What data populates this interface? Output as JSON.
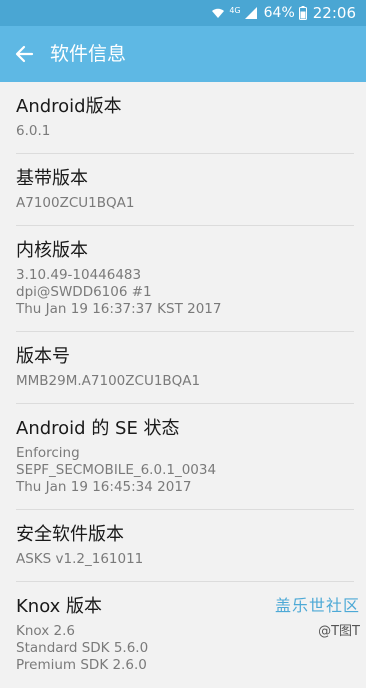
{
  "status_bar": {
    "network": "4G",
    "battery": "64%",
    "time": "22:06"
  },
  "app_bar": {
    "title": "软件信息"
  },
  "items": [
    {
      "label": "Android版本",
      "values": [
        "6.0.1"
      ]
    },
    {
      "label": "基带版本",
      "values": [
        "A7100ZCU1BQA1"
      ]
    },
    {
      "label": "内核版本",
      "values": [
        "3.10.49-10446483",
        "dpi@SWDD6106 #1",
        "Thu Jan 19 16:37:37 KST 2017"
      ]
    },
    {
      "label": "版本号",
      "values": [
        "MMB29M.A7100ZCU1BQA1"
      ]
    },
    {
      "label": "Android 的 SE 状态",
      "values": [
        "Enforcing",
        "SEPF_SECMOBILE_6.0.1_0034",
        "Thu Jan 19 16:45:34 2017"
      ]
    },
    {
      "label": "安全软件版本",
      "values": [
        "ASKS v1.2_161011"
      ]
    },
    {
      "label": "Knox 版本",
      "values": [
        "Knox 2.6",
        "Standard SDK 5.6.0",
        "Premium SDK 2.6.0"
      ]
    }
  ],
  "watermark": {
    "main": "盖乐世社区",
    "handle": "@T图T"
  },
  "colors": {
    "status_bar": "#4aa6d3",
    "app_bar": "#5eb8e4",
    "background": "#f2f2f2"
  }
}
